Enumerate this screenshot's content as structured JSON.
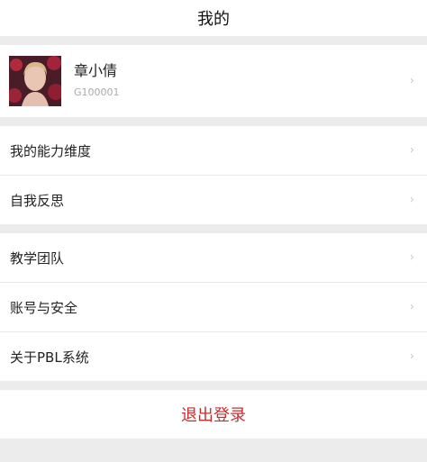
{
  "header": {
    "title": "我的"
  },
  "profile": {
    "name": "章小倩",
    "id": "G100001",
    "chevron": "›"
  },
  "group1": [
    {
      "label": "我的能力维度",
      "chevron": "›"
    },
    {
      "label": "自我反思",
      "chevron": "›"
    }
  ],
  "group2": [
    {
      "label": "教学团队",
      "chevron": "›"
    },
    {
      "label": "账号与安全",
      "chevron": "›"
    },
    {
      "label": "关于PBL系统",
      "chevron": "›"
    }
  ],
  "logout": {
    "label": "退出登录"
  },
  "colors": {
    "accent": "#c62d2d",
    "background": "#ececec"
  }
}
